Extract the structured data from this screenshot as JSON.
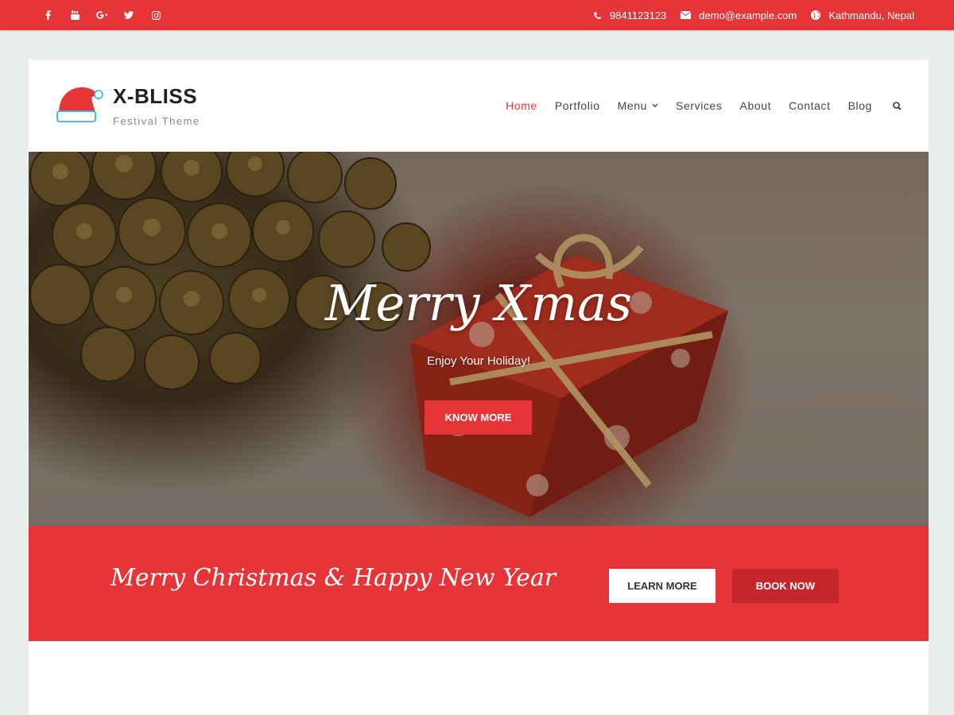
{
  "topbar": {
    "social": [
      {
        "icon": "facebook-icon"
      },
      {
        "icon": "youtube-icon"
      },
      {
        "icon": "google-plus-icon"
      },
      {
        "icon": "twitter-icon"
      },
      {
        "icon": "instagram-icon"
      }
    ],
    "phone": "9841123123",
    "email": "demo@example.com",
    "location": "Kathmandu, Nepal"
  },
  "header": {
    "title": "X-BLISS",
    "tagline": "Festival Theme",
    "logo_icon": "santa-hat-icon"
  },
  "nav": {
    "items": [
      {
        "label": "Home",
        "active": true
      },
      {
        "label": "Portfolio"
      },
      {
        "label": "Menu",
        "has_dropdown": true
      },
      {
        "label": "Services"
      },
      {
        "label": "About"
      },
      {
        "label": "Contact"
      },
      {
        "label": "Blog"
      }
    ],
    "search_icon": "search-icon"
  },
  "hero": {
    "title": "Merry Xmas",
    "subtitle": "Enjoy Your Holiday!",
    "button": "KNOW MORE"
  },
  "cta": {
    "text": "Merry Christmas & Happy New Year",
    "learn_more": "LEARN MORE",
    "book_now": "BOOK NOW"
  },
  "colors": {
    "accent": "#e63539",
    "accent_dark": "#c4272b",
    "background": "#e8eeed"
  }
}
